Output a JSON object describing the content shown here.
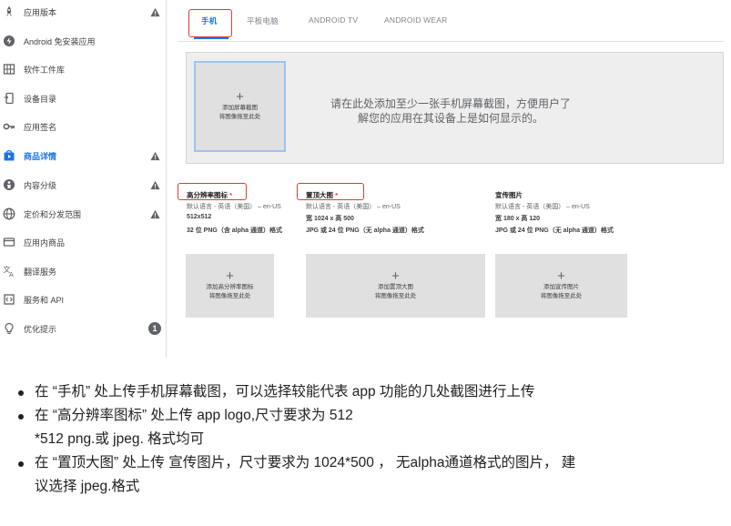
{
  "sidebar": {
    "items": [
      {
        "label": "应用版本",
        "icon": "rocket-icon",
        "warning": true
      },
      {
        "label": "Android 免安装应用",
        "icon": "instant-app-icon"
      },
      {
        "label": "软件工件库",
        "icon": "library-icon"
      },
      {
        "label": "设备目录",
        "icon": "device-catalog-icon"
      },
      {
        "label": "应用签名",
        "icon": "key-icon"
      },
      {
        "label": "商品详情",
        "icon": "store-listing-icon",
        "warning": true,
        "active": true
      },
      {
        "label": "内容分级",
        "icon": "content-rating-icon",
        "warning": true
      },
      {
        "label": "定价和分发范围",
        "icon": "globe-icon",
        "warning": true
      },
      {
        "label": "应用内商品",
        "icon": "in-app-products-icon"
      },
      {
        "label": "翻译服务",
        "icon": "translate-icon"
      },
      {
        "label": "服务和 API",
        "icon": "api-icon"
      },
      {
        "label": "优化提示",
        "icon": "lightbulb-icon",
        "badge": "1"
      }
    ]
  },
  "tabs": [
    {
      "label": "手机",
      "active": true
    },
    {
      "label": "平板电脑"
    },
    {
      "label": "ANDROID TV"
    },
    {
      "label": "ANDROID WEAR"
    }
  ],
  "screenshots": {
    "add_label": "添加屏幕截图",
    "drag_label": "将图像拖至此处",
    "hint_line1": "请在此处添加至少一张手机屏幕截图，方便用户了",
    "hint_line2": "解您的应用在其设备上是如何显示的。"
  },
  "assets": [
    {
      "title": "高分辨率图标",
      "required": "*",
      "language": "默认语言 - 英语（美国） – en-US",
      "size": "512x512",
      "format": "32 位 PNG（含 alpha 通道）格式",
      "add_label": "添加高分辨率图标",
      "drag_label": "将图像拖至此处"
    },
    {
      "title": "置顶大图",
      "required": "*",
      "language": "默认语言 - 英语（美国） – en-US",
      "size": "宽 1024 x 高 500",
      "format": "JPG 或 24 位 PNG（无 alpha 通道）格式",
      "add_label": "添加置顶大图",
      "drag_label": "将图像拖至此处"
    },
    {
      "title": "宣传图片",
      "required": "",
      "language": "默认语言 - 英语（美国） – en-US",
      "size": "宽 180 x 高 120",
      "format": "JPG 或 24 位 PNG（无 alpha 通道）格式",
      "add_label": "添加宣传图片",
      "drag_label": "将图像拖至此处"
    }
  ],
  "notes": [
    {
      "lines": [
        "在 “手机” 处上传手机屏幕截图，可以选择较能代表 app 功能的几处截图进行上传"
      ]
    },
    {
      "lines": [
        "在 “高分辨率图标” 处上传 app logo,尺寸要求为 512",
        "*512 png.或 jpeg. 格式均可"
      ]
    },
    {
      "lines": [
        "在 “置顶大图” 处上传 宣传图片，尺寸要求为 1024*500 ， 无alpha通道格式的图片， 建",
        "议选择 jpeg.格式"
      ]
    }
  ],
  "colors": {
    "accent": "#1a73e8",
    "highlight": "#e53935",
    "warning": "#5f6368"
  }
}
